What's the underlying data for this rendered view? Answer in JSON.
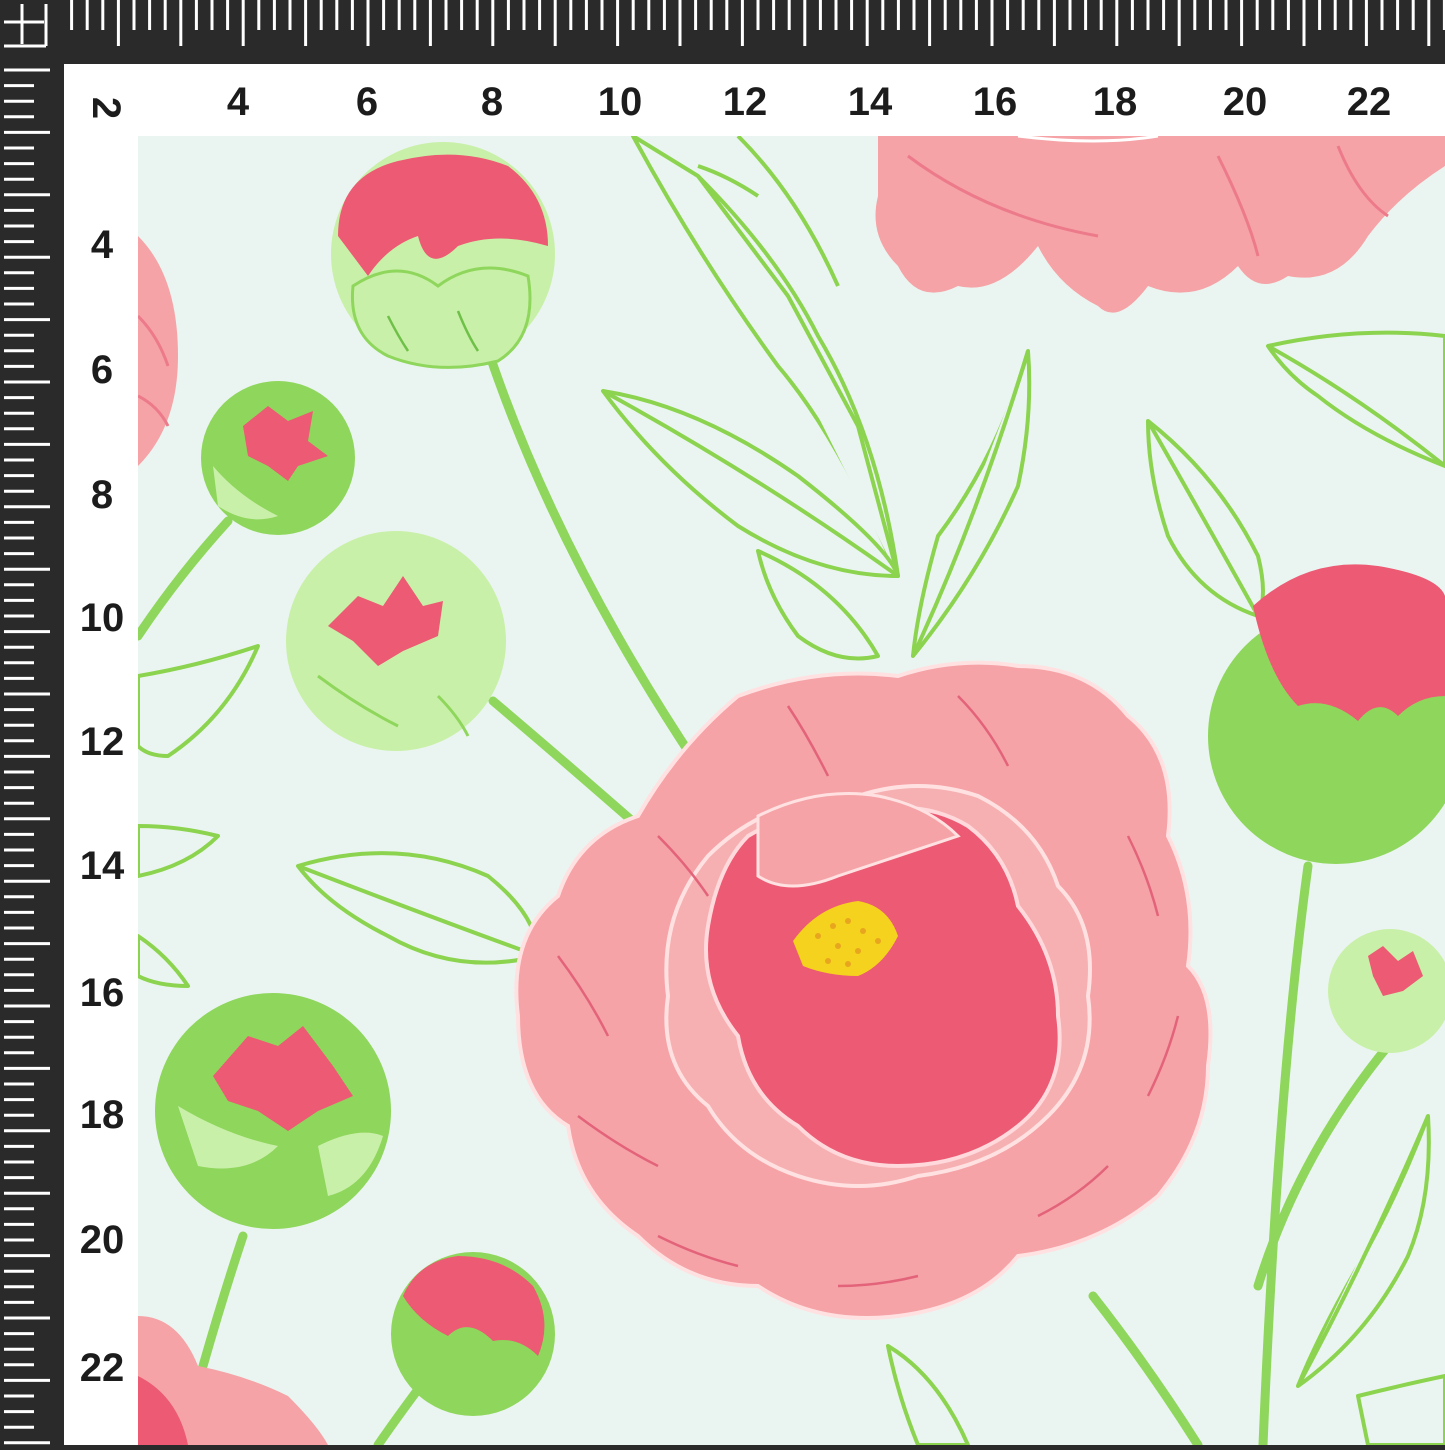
{
  "ruler": {
    "top_labels": [
      "4",
      "6",
      "8",
      "10",
      "12",
      "14",
      "16",
      "18",
      "20",
      "22"
    ],
    "left_labels": [
      "4",
      "6",
      "8",
      "10",
      "12",
      "14",
      "16",
      "18",
      "20",
      "22"
    ],
    "corner_label": "2"
  },
  "colors": {
    "ruler": "#2a2a2a",
    "ruler_ticks": "#ffffff",
    "frame": "#ffffff",
    "fabric_background": "#eaf5f1",
    "peony_light_pink": "#f5a3a6",
    "peony_dark_pink": "#ec5a73",
    "bud_green": "#8fd65c",
    "bud_light_green": "#c9f0a8",
    "leaf_outline": "#8cd44f",
    "pollen_yellow": "#f5d21e"
  },
  "icons": {
    "corner": "crosshair-icon"
  }
}
